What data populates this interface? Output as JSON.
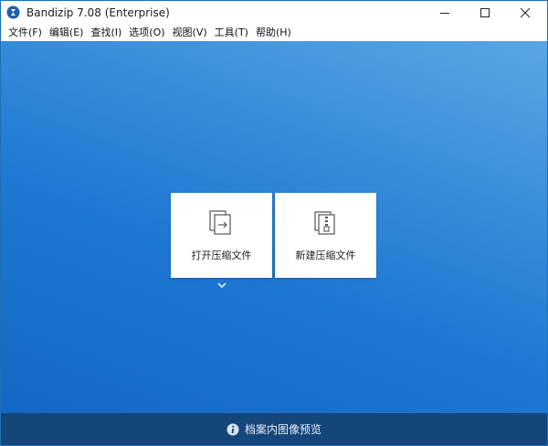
{
  "window": {
    "title": "Bandizip 7.08 (Enterprise)"
  },
  "menu": {
    "items": [
      {
        "label": "文件(F)"
      },
      {
        "label": "编辑(E)"
      },
      {
        "label": "查找(I)"
      },
      {
        "label": "选项(O)"
      },
      {
        "label": "视图(V)"
      },
      {
        "label": "工具(T)"
      },
      {
        "label": "帮助(H)"
      }
    ]
  },
  "main": {
    "open_archive_label": "打开压缩文件",
    "new_archive_label": "新建压缩文件"
  },
  "bottom": {
    "preview_label": "档案内图像预览"
  },
  "icons": {
    "app": "bandizip-logo-icon",
    "open": "open-archive-icon",
    "new": "new-archive-zip-icon",
    "dropdown": "chevron-down-icon",
    "info": "info-icon"
  },
  "colors": {
    "accent_blue": "#1d78d3",
    "bottom_bar": "#15467a"
  }
}
